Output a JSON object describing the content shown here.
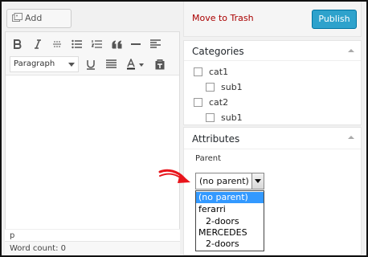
{
  "editor": {
    "add_media_label": "Add Media",
    "add_media_icon": "media-icon",
    "format_select": "Paragraph",
    "path": "p",
    "word_count": "Word count: 0",
    "toolbar_row1": [
      "bold-icon",
      "italic-icon",
      "strikethrough-icon",
      "bullet-list-icon",
      "numbered-list-icon",
      "blockquote-icon",
      "horizontal-rule-icon",
      "align-left-icon"
    ],
    "toolbar_row2": [
      "underline-icon",
      "justify-icon",
      "text-color-icon",
      "paste-text-icon"
    ]
  },
  "publish": {
    "trash_label": "Move to Trash",
    "publish_label": "Publish",
    "publish_color": "#2ea2cc",
    "trash_color": "#aa0000"
  },
  "categories": {
    "title": "Categories",
    "items": [
      {
        "label": "cat1",
        "level": 0,
        "checked": false
      },
      {
        "label": "sub1",
        "level": 1,
        "checked": false
      },
      {
        "label": "cat2",
        "level": 0,
        "checked": false
      },
      {
        "label": "sub1",
        "level": 1,
        "checked": false
      }
    ]
  },
  "attributes": {
    "title": "Attributes",
    "parent_label": "Parent",
    "parent_value": "(no parent)",
    "options": [
      {
        "label": "(no parent)",
        "selected": true,
        "indent": false
      },
      {
        "label": "ferarri",
        "selected": false,
        "indent": false
      },
      {
        "label": "2-doors",
        "selected": false,
        "indent": true
      },
      {
        "label": "MERCEDES",
        "selected": false,
        "indent": false
      },
      {
        "label": "2-doors",
        "selected": false,
        "indent": true
      }
    ]
  },
  "annotation": {
    "arrow_color": "#e8141b",
    "arrow_icon": "red-arrow-icon"
  }
}
